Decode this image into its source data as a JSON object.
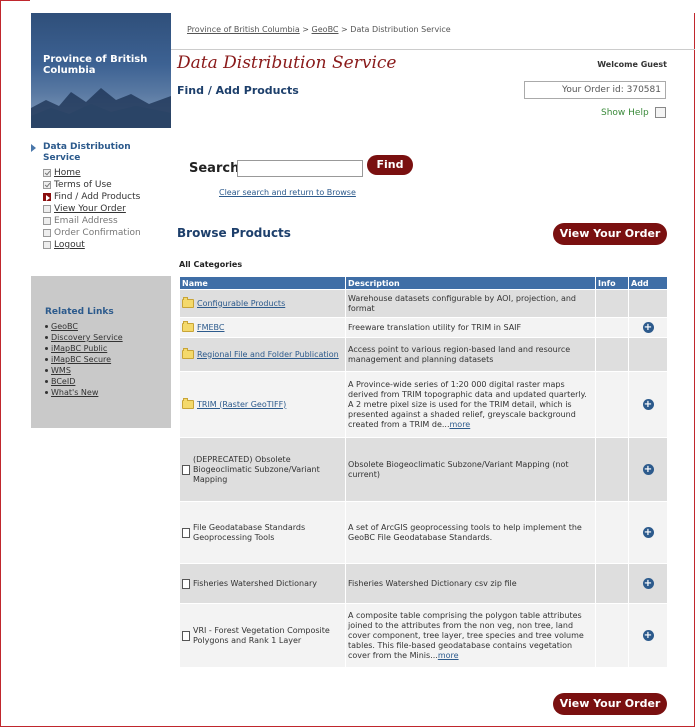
{
  "breadcrumb": {
    "part1": "Province of British Columbia",
    "sep1": ">",
    "part2": "GeoBC",
    "sep2": ">",
    "part3": "Data Distribution Service"
  },
  "sidebar": {
    "brand": "Province of British Columbia",
    "nav_title": "Data Distribution Service",
    "nav": [
      {
        "label": "Home",
        "state": "done"
      },
      {
        "label": "Terms of Use",
        "state": "done"
      },
      {
        "label": "Find / Add Products",
        "state": "current"
      },
      {
        "label": "View Your Order",
        "state": "todo"
      },
      {
        "label": "Email Address",
        "state": "disabled"
      },
      {
        "label": "Order Confirmation",
        "state": "disabled"
      },
      {
        "label": "Logout",
        "state": "link"
      }
    ],
    "related_title": "Related Links",
    "related": [
      "GeoBC",
      "Discovery Service",
      "iMapBC Public",
      "iMapBC Secure",
      "WMS",
      "BCeID",
      "What's New"
    ]
  },
  "header": {
    "title": "Data Distribution Service",
    "welcome": "Welcome Guest",
    "subtitle": "Find / Add Products",
    "order_id": "Your Order id: 370581",
    "show_help": "Show Help"
  },
  "search": {
    "label": "Search",
    "value": "",
    "button": "Find",
    "clear_link": "Clear search and return to Browse"
  },
  "browse": {
    "title": "Browse Products",
    "view_order_button": "View Your Order",
    "category": "All Categories",
    "columns": [
      "Name",
      "Description",
      "Info",
      "Add"
    ],
    "rows": [
      {
        "name": "Configurable Products",
        "type": "folder",
        "desc": "Warehouse datasets configurable by AOI, projection, and format",
        "more": "",
        "add": false
      },
      {
        "name": "FMEBC",
        "type": "folder",
        "desc": "Freeware translation utility for TRIM in SAIF",
        "more": "",
        "add": true
      },
      {
        "name": "Regional File and Folder Publication",
        "type": "folder",
        "desc": "Access point to various region-based land and resource management and planning datasets",
        "more": "",
        "add": false
      },
      {
        "name": "TRIM (Raster GeoTIFF)",
        "type": "folder",
        "desc": "A Province-wide series of 1:20 000 digital raster maps derived from TRIM topographic data and updated quarterly. A 2 metre pixel size is used for the TRIM detail, which is presented against a shaded relief, greyscale background created from a TRIM de...",
        "more": "more",
        "add": true
      },
      {
        "name": "(DEPRECATED) Obsolete Biogeoclimatic Subzone/Variant Mapping",
        "type": "doc",
        "desc": "Obsolete Biogeoclimatic Subzone/Variant Mapping (not current)",
        "more": "",
        "add": true
      },
      {
        "name": "File Geodatabase Standards Geoprocessing Tools",
        "type": "doc",
        "desc": "A set of ArcGIS geoprocessing tools to help implement the GeoBC File Geodatabase Standards.",
        "more": "",
        "add": true
      },
      {
        "name": "Fisheries Watershed Dictionary",
        "type": "doc",
        "desc": "Fisheries Watershed Dictionary csv zip file",
        "more": "",
        "add": true
      },
      {
        "name": "VRI - Forest Vegetation Composite Polygons and Rank 1 Layer",
        "type": "doc",
        "desc": "A composite table comprising the polygon table attributes joined to the attributes from the non veg, non tree, land cover component, tree layer, tree species and tree volume tables. This file-based geodatabase contains vegetation cover from the Minis...",
        "more": "more",
        "add": true
      }
    ]
  },
  "colors": {
    "accent_red": "#7a1010",
    "header_blue": "#3f6ea6",
    "title_red": "#8a1a1a",
    "link_blue": "#2c5a8c"
  }
}
